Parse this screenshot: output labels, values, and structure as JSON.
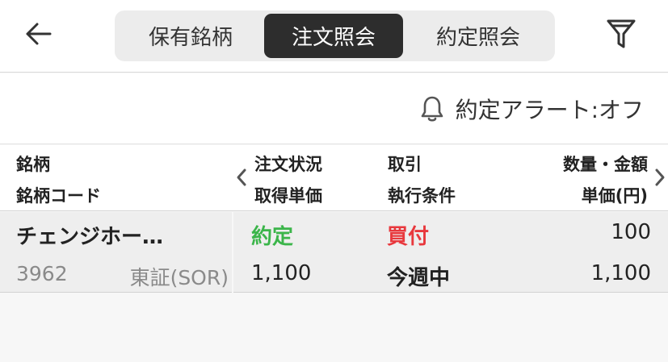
{
  "header": {
    "tabs": [
      {
        "label": "保有銘柄"
      },
      {
        "label": "注文照会"
      },
      {
        "label": "約定照会"
      }
    ]
  },
  "alert": {
    "label": "約定アラート:オフ"
  },
  "columns": {
    "name": "銘柄",
    "code": "銘柄コード",
    "status": "注文状況",
    "acq_price": "取得単価",
    "trade": "取引",
    "exec_cond": "執行条件",
    "qty_amount": "数量・金額",
    "unit_price": "単価(円)"
  },
  "orders": [
    {
      "name": "チェンジホー…",
      "code": "3962",
      "market": "東証(SOR)",
      "status": "約定",
      "acq_price": "1,100",
      "trade": "買付",
      "exec_cond": "今週中",
      "quantity": "100",
      "unit_price": "1,100"
    }
  ],
  "colors": {
    "status_done": "#3bb54a",
    "buy": "#e8383d",
    "active_tab_bg": "#2d2d2d"
  }
}
